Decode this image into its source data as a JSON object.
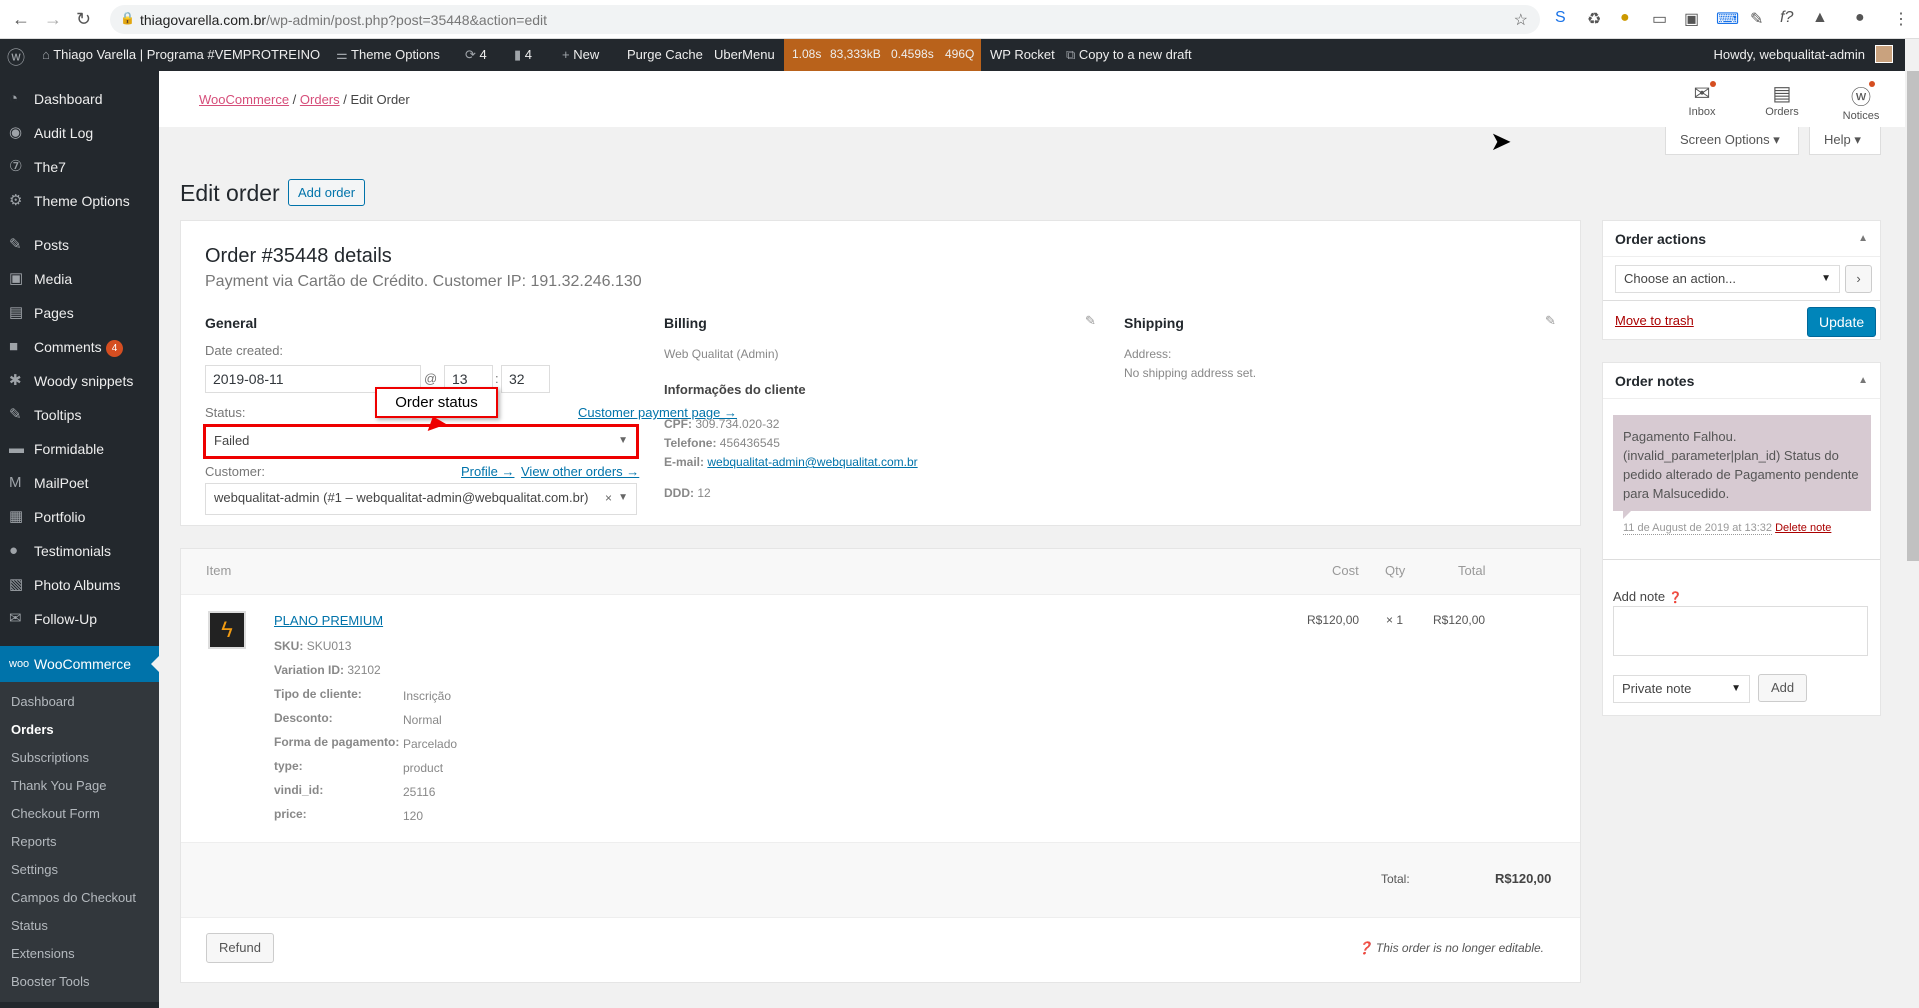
{
  "browser": {
    "url_host": "thiagovarella.com.br",
    "url_path": "/wp-admin/post.php?post=35448&action=edit"
  },
  "adminbar": {
    "site": "Thiago Varella | Programa #VEMPROTREINO",
    "theme_options": "Theme Options",
    "updates": "4",
    "comments": "4",
    "new": "New",
    "purge": "Purge Cache",
    "ubermenu": "UberMenu",
    "qm": [
      "1.08s",
      "83,333kB",
      "0.4598s",
      "496Q"
    ],
    "wprocket": "WP Rocket",
    "copy": "Copy to a new draft",
    "howdy": "Howdy, webqualitat-admin"
  },
  "sidebar": {
    "items": [
      {
        "label": "Dashboard",
        "icon": "dashboard-icon",
        "g": "◔"
      },
      {
        "label": "Audit Log",
        "icon": "audit-icon",
        "g": "◉"
      },
      {
        "label": "The7",
        "icon": "the7-icon",
        "g": "⑦"
      },
      {
        "label": "Theme Options",
        "icon": "gear-icon",
        "g": "⚙"
      }
    ],
    "items2": [
      {
        "label": "Posts",
        "icon": "pin-icon",
        "g": "✎"
      },
      {
        "label": "Media",
        "icon": "media-icon",
        "g": "▣"
      },
      {
        "label": "Pages",
        "icon": "pages-icon",
        "g": "▤"
      },
      {
        "label": "Comments",
        "icon": "comment-icon",
        "g": "■",
        "badge": "4"
      },
      {
        "label": "Woody snippets",
        "icon": "snippet-icon",
        "g": "✱"
      },
      {
        "label": "Tooltips",
        "icon": "pin-icon",
        "g": "✎"
      },
      {
        "label": "Formidable",
        "icon": "formidable-icon",
        "g": "▬"
      },
      {
        "label": "MailPoet",
        "icon": "mailpoet-icon",
        "g": "M"
      },
      {
        "label": "Portfolio",
        "icon": "portfolio-icon",
        "g": "▦"
      },
      {
        "label": "Testimonials",
        "icon": "testimonial-icon",
        "g": "●"
      },
      {
        "label": "Photo Albums",
        "icon": "album-icon",
        "g": "▧"
      },
      {
        "label": "Follow-Up",
        "icon": "mail-icon",
        "g": "✉"
      }
    ],
    "woo": "WooCommerce",
    "sub": [
      "Dashboard",
      "Orders",
      "Subscriptions",
      "Thank You Page",
      "Checkout Form",
      "Reports",
      "Settings",
      "Campos do Checkout",
      "Status",
      "Extensions",
      "Booster Tools"
    ]
  },
  "header": {
    "crumb": [
      "WooCommerce",
      "Orders",
      "Edit Order"
    ],
    "inbox": "Inbox",
    "orders": "Orders",
    "notices": "Notices",
    "screen_options": "Screen Options",
    "help": "Help"
  },
  "page": {
    "title": "Edit order",
    "add": "Add order"
  },
  "order": {
    "title": "Order #35448 details",
    "subtitle": "Payment via Cartão de Crédito. Customer IP: 191.32.246.130",
    "general": "General",
    "date_label": "Date created:",
    "date": "2019-08-11",
    "at": "@",
    "hour": "13",
    "minute": "32",
    "status_label": "Status:",
    "payment_page": "Customer payment page →",
    "status": "Failed",
    "customer_label": "Customer:",
    "profile": "Profile →",
    "other_orders": "View other orders →",
    "customer": "webqualitat-admin (#1 – webqualitat-admin@webqualitat.com.br)",
    "callout": "Order status",
    "billing": {
      "title": "Billing",
      "name": "Web Qualitat (Admin)",
      "info_title": "Informações do cliente",
      "cpf_l": "CPF:",
      "cpf": "309.734.020-32",
      "tel_l": "Telefone:",
      "tel": "456436545",
      "email_l": "E-mail:",
      "email": "webqualitat-admin@webqualitat.com.br",
      "ddd_l": "DDD:",
      "ddd": "12"
    },
    "shipping": {
      "title": "Shipping",
      "addr_l": "Address:",
      "addr": "No shipping address set."
    }
  },
  "items": {
    "headers": {
      "item": "Item",
      "cost": "Cost",
      "qty": "Qty",
      "total": "Total"
    },
    "product": {
      "name": "PLANO PREMIUM",
      "sku": "SKU013",
      "sku_l": "SKU:",
      "var_l": "Variation ID:",
      "var": "32102",
      "cost": "R$120,00",
      "qty": "× 1",
      "total": "R$120,00",
      "meta": [
        [
          "Tipo de cliente:",
          "Inscrição"
        ],
        [
          "Desconto:",
          "Normal"
        ],
        [
          "Forma de pagamento:",
          "Parcelado"
        ],
        [
          "type:",
          "product"
        ],
        [
          "vindi_id:",
          "25116"
        ],
        [
          "price:",
          "120"
        ]
      ]
    },
    "total_label": "Total:",
    "total": "R$120,00",
    "refund": "Refund",
    "not_editable": "This order is no longer editable."
  },
  "actions": {
    "title": "Order actions",
    "choose": "Choose an action...",
    "trash": "Move to trash",
    "update": "Update"
  },
  "notes": {
    "title": "Order notes",
    "note": "Pagamento Falhou. (invalid_parameter|plan_id) Status do pedido alterado de Pagamento pendente para Malsucedido.",
    "date": "11 de August de 2019 at 13:32",
    "delete": "Delete note",
    "add_label": "Add note",
    "type": "Private note",
    "add": "Add"
  }
}
